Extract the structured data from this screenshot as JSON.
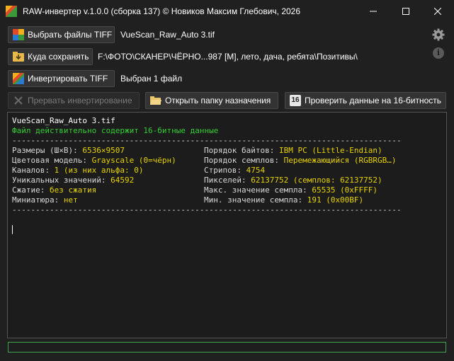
{
  "window": {
    "title": "RAW-инвертер v.1.0.0 (сборка 137) © Новиков Максим Глебович, 2026"
  },
  "toolbar": {
    "select_files_label": "Выбрать файлы TIFF",
    "selected_filename": "VueScan_Raw_Auto 3.tif",
    "save_to_label": "Куда сохранять",
    "save_path": "F:\\ФОТО\\СКАНЕР\\ЧЁРНО...987 [M], лето, дача, ребята\\Позитивы\\",
    "invert_label": "Инвертировать TIFF",
    "selected_count": "Выбран 1 файл",
    "abort_label": "Прервать инвертирование",
    "open_folder_label": "Открыть папку назначения",
    "check16_label": "Проверить данные на 16-битность",
    "check16_icon_text": "16"
  },
  "console": {
    "filename": "VueScan_Raw_Auto 3.tif",
    "status": "Файл действительно содержит 16-битные данные",
    "separator": "-----------------------------------------------------------------------------------",
    "left": [
      {
        "label": "Размеры (Ш×В): ",
        "value": "6536×9507"
      },
      {
        "label": "Цветовая модель: ",
        "value": "Grayscale (0=чёрн)"
      },
      {
        "label": "Каналов: ",
        "value": "1 (из них альфа: 0)"
      },
      {
        "label": "Уникальных значений: ",
        "value": "64592"
      },
      {
        "label": "Сжатие: ",
        "value": "без сжатия"
      },
      {
        "label": "Миниатюра: ",
        "value": "нет"
      }
    ],
    "right": [
      {
        "label": "Порядок байтов: ",
        "value": "IBM PC (Little-Endian)"
      },
      {
        "label": "Порядок семплов: ",
        "value": "Перемежающийся (RGBRGB…)"
      },
      {
        "label": "Стрипов: ",
        "value": "4754"
      },
      {
        "label": "Пикселей: ",
        "value": "62137752 (семплов: 62137752)"
      },
      {
        "label": "Макс. значение семпла: ",
        "value": "65535 (0xFFFF)"
      },
      {
        "label": "Мин. значение семпла: ",
        "value": "191 (0x00BF)"
      }
    ]
  },
  "progress": {
    "fraction": 0
  },
  "colors": {
    "accent_green": "#3fa34d",
    "value_yellow": "#e6d200",
    "status_green": "#33cc33"
  },
  "icons": {
    "app": "app-icon",
    "select_files": "multicolor-tiles-icon",
    "save_to": "download-folder-icon",
    "invert": "multicolor-tiles-icon",
    "abort": "x-icon",
    "open_folder": "folder-icon",
    "check16": "16-badge-icon",
    "settings": "gear-icon",
    "about": "info-icon"
  }
}
